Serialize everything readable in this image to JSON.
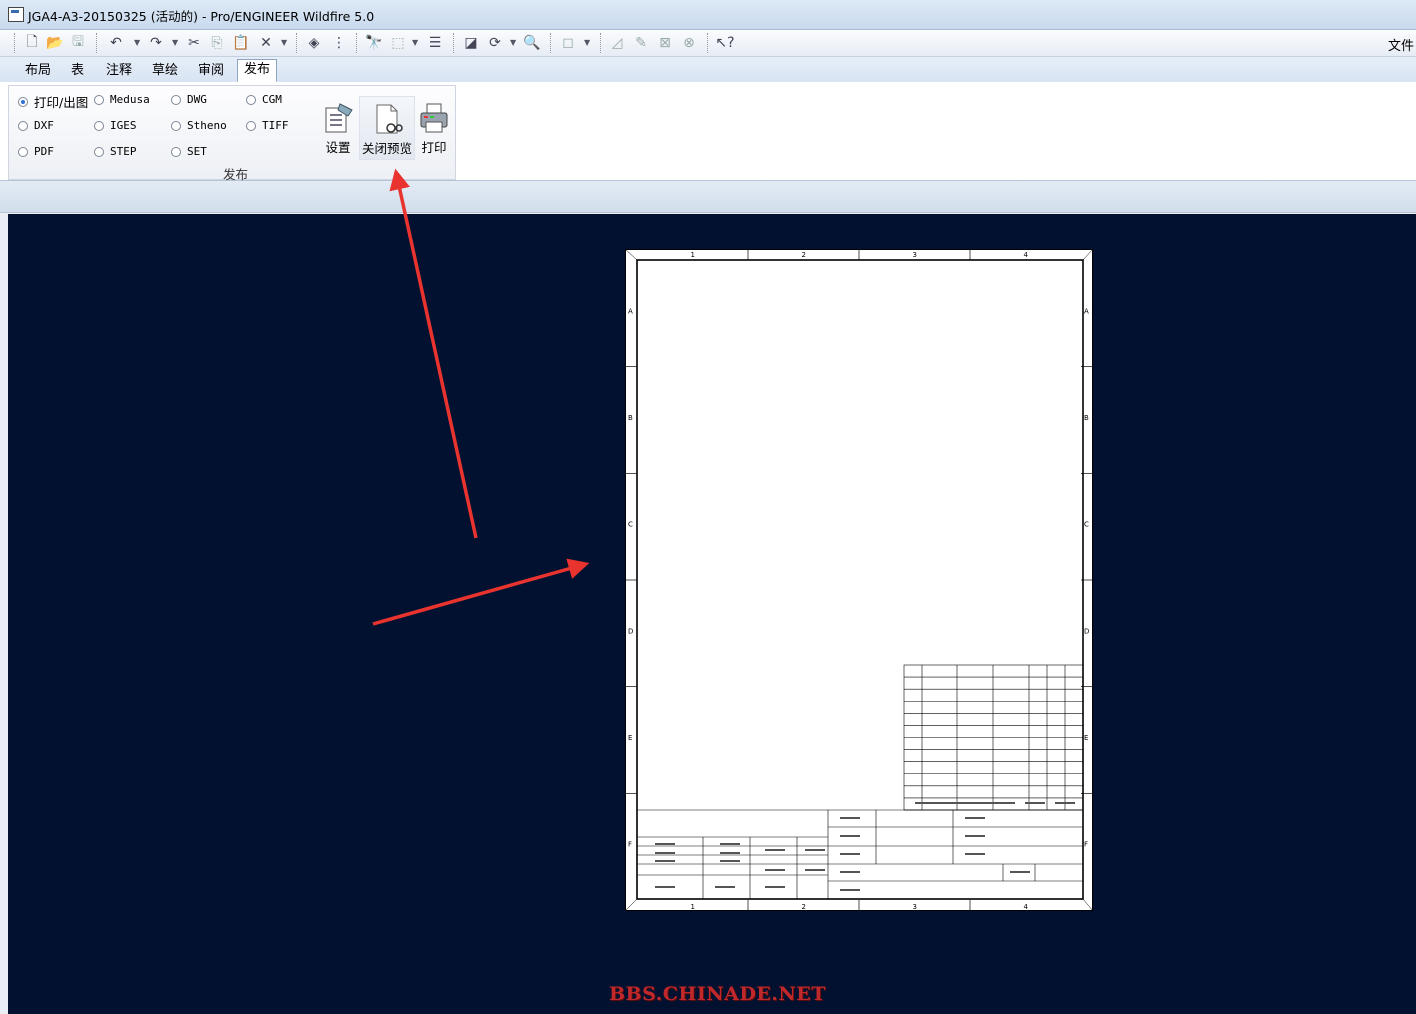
{
  "window": {
    "title": "JGA4-A3-20150325 (活动的) - Pro/ENGINEER Wildfire 5.0"
  },
  "toolbar": {
    "icons": [
      "new-file-icon",
      "open-folder-icon",
      "save-icon",
      "undo-icon",
      "redo-icon",
      "cut-icon",
      "copy-icon",
      "paste-icon",
      "delete-icon",
      "layers-icon",
      "model-tree-icon",
      "find-icon",
      "select-box-icon",
      "properties-icon",
      "repaint-icon",
      "regenerate-icon",
      "zoom-icon",
      "view-icon",
      "measure-icon",
      "edit-icon",
      "cross-icon",
      "erase-icon",
      "context-help-icon"
    ],
    "file_menu": "文件"
  },
  "tabs": [
    {
      "label": "布局",
      "active": false
    },
    {
      "label": "表",
      "active": false
    },
    {
      "label": "注释",
      "active": false
    },
    {
      "label": "草绘",
      "active": false
    },
    {
      "label": "审阅",
      "active": false
    },
    {
      "label": "发布",
      "active": true
    }
  ],
  "publish": {
    "formats": [
      {
        "label": "打印/出图",
        "checked": true
      },
      {
        "label": "Medusa",
        "checked": false
      },
      {
        "label": "DWG",
        "checked": false
      },
      {
        "label": "CGM",
        "checked": false
      },
      {
        "label": "DXF",
        "checked": false
      },
      {
        "label": "IGES",
        "checked": false
      },
      {
        "label": "Stheno",
        "checked": false
      },
      {
        "label": "TIFF",
        "checked": false
      },
      {
        "label": "PDF",
        "checked": false
      },
      {
        "label": "STEP",
        "checked": false
      },
      {
        "label": "SET",
        "checked": false
      }
    ],
    "settings_label": "设置",
    "close_preview_label": "关闭预览",
    "print_label": "打印",
    "group_label": "发布"
  },
  "drawing": {
    "zone_columns": [
      "1",
      "2",
      "3",
      "4"
    ],
    "zone_rows": [
      "A",
      "B",
      "C",
      "D",
      "E",
      "F"
    ]
  },
  "watermark": "BBS.CHINADE.NET",
  "colors": {
    "canvas": "#02112f",
    "arrow": "#e8332f",
    "watermark": "#c0292b"
  }
}
